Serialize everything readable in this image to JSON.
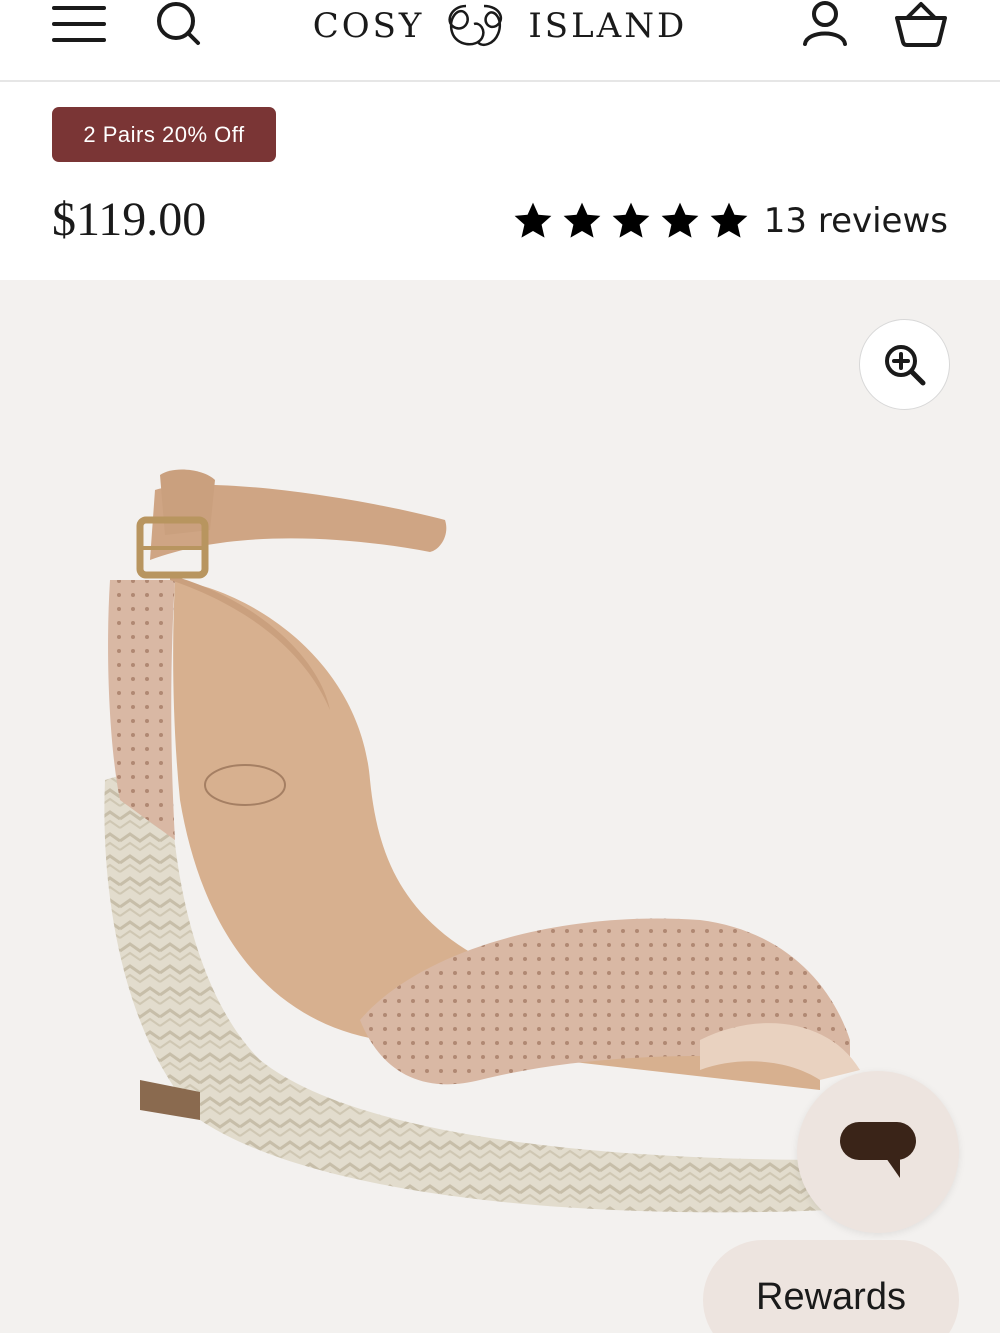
{
  "header": {
    "menu_icon": "hamburger-menu-icon",
    "search_icon": "search-icon",
    "logo_left": "COSY",
    "logo_right": "ISLAND",
    "account_icon": "user-icon",
    "cart_icon": "basket-icon"
  },
  "promo": {
    "label": "2 Pairs 20% Off",
    "color": "#7a3535"
  },
  "product": {
    "price": "$119.00",
    "rating": {
      "stars": 5,
      "max": 5,
      "reviews_label": "13 reviews"
    }
  },
  "gallery": {
    "zoom_icon": "zoom-in-icon",
    "image": "espadrille-wedge-sandal"
  },
  "chat": {
    "icon": "chat-bubble-icon"
  },
  "rewards": {
    "label": "Rewards"
  },
  "colors": {
    "accent": "#7a3535",
    "widget_bg": "#ede4df",
    "gallery_bg": "#f3f1ef"
  }
}
